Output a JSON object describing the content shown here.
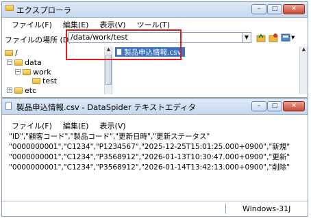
{
  "explorer": {
    "title": "エクスプローラ",
    "menu": [
      "ファイル(F)",
      "編集(E)",
      "表示(V)",
      "ツール(T)"
    ],
    "address_label": "ファイルの場所 (D)",
    "address_value": "/data/work/test",
    "tree": {
      "root": "/",
      "data": "data",
      "work": "work",
      "test": "test",
      "etc": "etc"
    },
    "selected_file": "製品申込情報.csv"
  },
  "editor": {
    "title": "製品申込情報.csv - DataSpider テキストエディタ",
    "menu": [
      "ファイル(F)",
      "編集(E)",
      "表示(V)"
    ],
    "lines": [
      "\"ID\",\"顧客コード\",\"製品コード\",\"更新日時\",\"更新ステータス\"",
      "\"0000000001\",\"C1234\",\"P1234567\",\"2025-12-25T15:01:25.000+0900\",\"新規\"",
      "\"0000000001\",\"C1234\",\"P3568912\",\"2026-01-13T10:30:47.000+0900\",\"更新\"",
      "\"0000000001\",\"C1234\",\"P3568912\",\"2026-01-14T13:42:13.000+0900\",\"削除\""
    ],
    "status_encoding": "Windows-31J"
  },
  "window_buttons": {
    "minimize": "–",
    "maximize": "□",
    "close": "✕"
  },
  "icons": [
    "folder-icon",
    "file-icon",
    "dropdown-arrow-icon",
    "toolbar-icon"
  ]
}
